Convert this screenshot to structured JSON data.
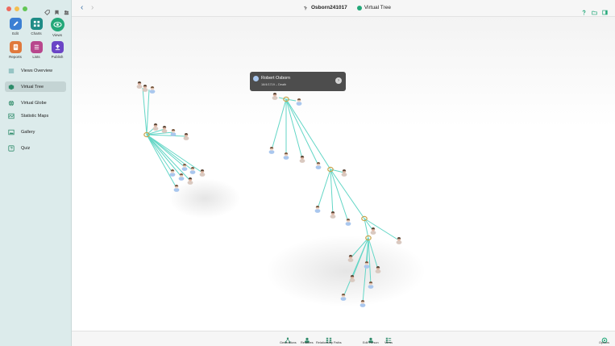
{
  "window": {
    "title": "Osborn241017",
    "view_title": "Virtual Tree"
  },
  "toolbar": {
    "edit": "Edit",
    "charts": "Charts",
    "views": "Views",
    "reports": "Reports",
    "lists": "Lists",
    "publish": "Publish"
  },
  "sidebar": {
    "items": [
      {
        "label": "Views Overview"
      },
      {
        "label": "Virtual Tree"
      },
      {
        "label": "Virtual Globe"
      },
      {
        "label": "Statistic Maps"
      },
      {
        "label": "Gallery"
      },
      {
        "label": "Quiz"
      }
    ]
  },
  "popup": {
    "name": "Robert Osborn",
    "detail": "16/4/1719 – Death"
  },
  "bottombar": {
    "generations": "Generations",
    "relatives": "Relatives",
    "relationship_paths": "Relationship Paths",
    "edit_person": "Edit Person",
    "views": "Views",
    "options": "Options"
  },
  "colors": {
    "accent": "#23a879",
    "link_line": "#63d6c6",
    "female": "#a9c7ee",
    "male": "#e3b9a6"
  }
}
